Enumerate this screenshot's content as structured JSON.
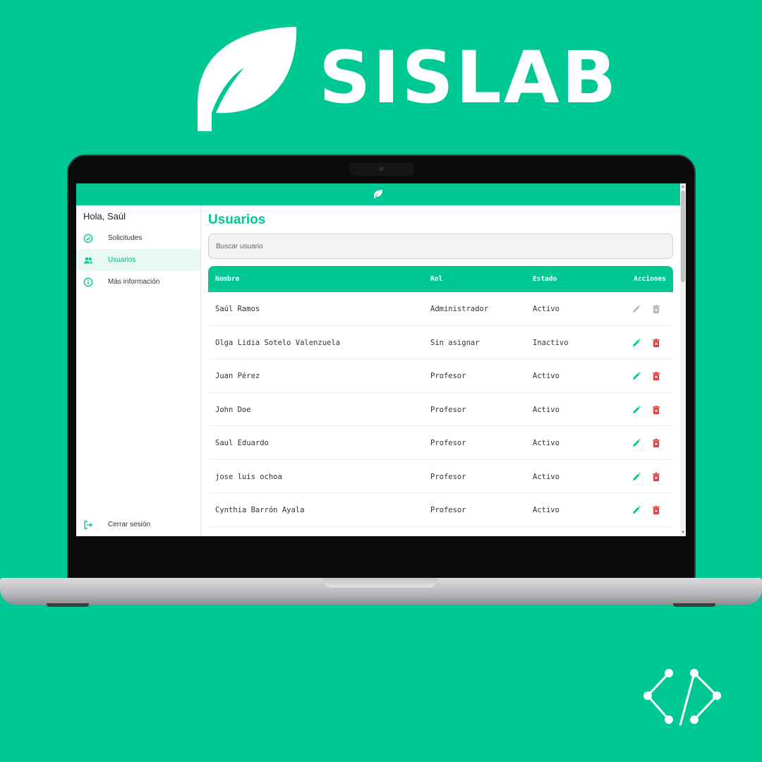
{
  "brand": {
    "name": "SISLAB"
  },
  "colors": {
    "accent": "#00c894",
    "danger": "#e53935",
    "disabled": "#b5b5b5"
  },
  "sidebar": {
    "greeting": "Hola, Saúl",
    "items": [
      {
        "label": "Solicitudes",
        "icon": "check-circle-icon"
      },
      {
        "label": "Usuarios",
        "icon": "users-icon",
        "active": true
      },
      {
        "label": "Más información",
        "icon": "info-icon"
      }
    ],
    "logout": {
      "label": "Cerrar sesión",
      "icon": "logout-icon"
    }
  },
  "main": {
    "title": "Usuarios",
    "search": {
      "placeholder": "Buscar usuario",
      "value": ""
    },
    "table": {
      "columns": [
        "Nombre",
        "Rol",
        "Estado",
        "Acciones"
      ],
      "rows": [
        {
          "nombre": "Saúl Ramos",
          "rol": "Administrador",
          "estado": "Activo",
          "actions_enabled": false
        },
        {
          "nombre": "Olga Lidia Sotelo Valenzuela",
          "rol": "Sin asignar",
          "estado": "Inactivo",
          "actions_enabled": true
        },
        {
          "nombre": "Juan Pérez",
          "rol": "Profesor",
          "estado": "Activo",
          "actions_enabled": true
        },
        {
          "nombre": "John Doe",
          "rol": "Profesor",
          "estado": "Activo",
          "actions_enabled": true
        },
        {
          "nombre": "Saul Eduardo",
          "rol": "Profesor",
          "estado": "Activo",
          "actions_enabled": true
        },
        {
          "nombre": "jose luis ochoa",
          "rol": "Profesor",
          "estado": "Activo",
          "actions_enabled": true
        },
        {
          "nombre": "Cynthia Barrón Ayala",
          "rol": "Profesor",
          "estado": "Activo",
          "actions_enabled": true
        }
      ]
    }
  }
}
